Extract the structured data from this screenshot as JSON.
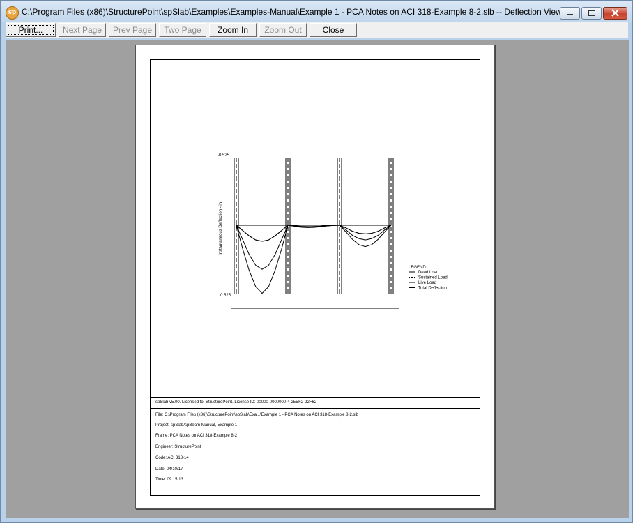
{
  "window": {
    "app_icon_text": "sp",
    "title": "C:\\Program Files (x86)\\StructurePoint\\spSlab\\Examples\\Examples-Manual\\Example 1 - PCA Notes on ACI 318-Example 8-2.slb -- Deflection View"
  },
  "toolbar": {
    "print": "Print...",
    "next_page": "Next Page",
    "prev_page": "Prev Page",
    "two_page": "Two Page",
    "zoom_in": "Zoom In",
    "zoom_out": "Zoom Out",
    "close": "Close"
  },
  "report": {
    "license_line": "spSlab v5.00. Licensed to: StructurePoint. License ID: 00000-0000000-4-25EF2-22F62",
    "file": "File: C:\\Program Files (x86)\\StructurePoint\\spSlab\\Exa...\\Example 1 - PCA Notes on ACI 318-Example 8-2.slb",
    "project": "Project: spSlab/spBeam Manual, Example 1",
    "frame": "Frame: PCA Notes on ACI 318-Example 8-2",
    "engineer": "Engineer: StructurePoint",
    "code": "Code: ACI 318-14",
    "date": "Date: 04/10/17",
    "time": "Time: 09:15:13"
  },
  "chart_data": {
    "type": "line",
    "ylabel": "Instantaneous Deflection - in",
    "ylim": [
      -0.525,
      0.525
    ],
    "yticks": [
      "-0.525",
      "0.525"
    ],
    "legend_title": "LEGEND:",
    "legend_position": "right",
    "x": [
      0,
      0.125,
      0.25,
      0.375,
      0.5,
      0.625,
      0.75,
      0.875,
      1.0,
      1.125,
      1.25,
      1.375,
      1.5,
      1.625,
      1.75,
      1.875,
      2.0,
      2.125,
      2.25,
      2.375,
      2.5,
      2.625,
      2.75,
      2.875,
      3.0
    ],
    "supports": [
      0,
      1,
      2,
      3
    ],
    "series": [
      {
        "name": "Dead Load",
        "style": "solid",
        "values": [
          0,
          0.04,
          0.08,
          0.11,
          0.12,
          0.11,
          0.08,
          0.04,
          0,
          0.005,
          0.01,
          0.012,
          0.01,
          0.008,
          0.004,
          0.002,
          0,
          0.02,
          0.045,
          0.06,
          0.065,
          0.06,
          0.045,
          0.02,
          0
        ]
      },
      {
        "name": "Sustained Load",
        "style": "dashed",
        "values": [
          0,
          0.04,
          0.08,
          0.11,
          0.12,
          0.11,
          0.08,
          0.04,
          0,
          0.005,
          0.01,
          0.012,
          0.01,
          0.008,
          0.004,
          0.002,
          0,
          0.02,
          0.045,
          0.06,
          0.065,
          0.06,
          0.045,
          0.02,
          0
        ]
      },
      {
        "name": "Live Load",
        "style": "solid",
        "values": [
          0,
          0.11,
          0.22,
          0.3,
          0.33,
          0.3,
          0.22,
          0.11,
          0,
          0.004,
          0.008,
          0.01,
          0.01,
          0.008,
          0.004,
          0.001,
          0,
          0.035,
          0.075,
          0.1,
          0.11,
          0.1,
          0.075,
          0.035,
          0
        ]
      },
      {
        "name": "Total Deflection",
        "style": "solid",
        "values": [
          0,
          0.18,
          0.34,
          0.46,
          0.51,
          0.46,
          0.34,
          0.18,
          0,
          0.008,
          0.015,
          0.018,
          0.016,
          0.012,
          0.006,
          0.002,
          0,
          0.05,
          0.105,
          0.145,
          0.16,
          0.145,
          0.105,
          0.05,
          0
        ]
      }
    ]
  }
}
